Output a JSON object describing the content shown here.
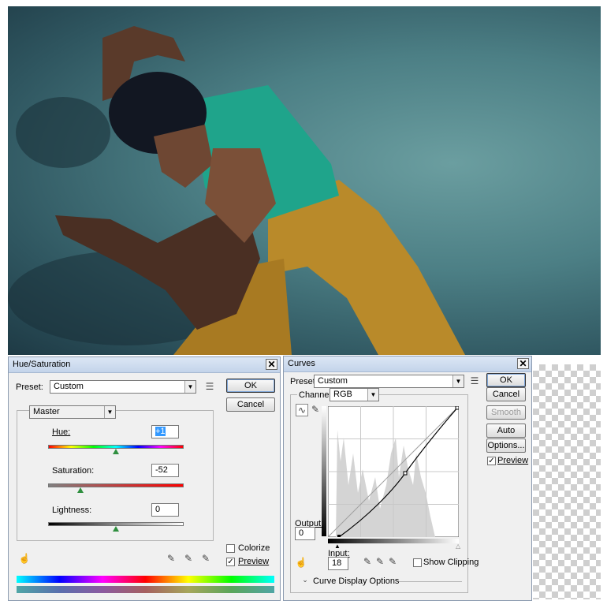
{
  "hue_saturation": {
    "title": "Hue/Saturation",
    "preset_label": "Preset:",
    "preset_value": "Custom",
    "ok_label": "OK",
    "cancel_label": "Cancel",
    "channel_value": "Master",
    "hue_label": "Hue:",
    "hue_value": "+1",
    "saturation_label": "Saturation:",
    "saturation_value": "-52",
    "lightness_label": "Lightness:",
    "lightness_value": "0",
    "colorize_label": "Colorize",
    "preview_label": "Preview",
    "colorize_checked": false,
    "preview_checked": true
  },
  "curves": {
    "title": "Curves",
    "preset_label": "Preset:",
    "preset_value": "Custom",
    "channel_label": "Channel:",
    "channel_value": "RGB",
    "ok_label": "OK",
    "cancel_label": "Cancel",
    "smooth_label": "Smooth",
    "auto_label": "Auto",
    "options_label": "Options...",
    "preview_label": "Preview",
    "output_label": "Output:",
    "output_value": "0",
    "input_label": "Input:",
    "input_value": "18",
    "show_clipping_label": "Show Clipping",
    "display_options_label": "Curve Display Options"
  },
  "colors": {
    "dialog_bg": "#f0f0f0",
    "slider_thumb": "#2f8f3f",
    "selection": "#3399ff"
  }
}
